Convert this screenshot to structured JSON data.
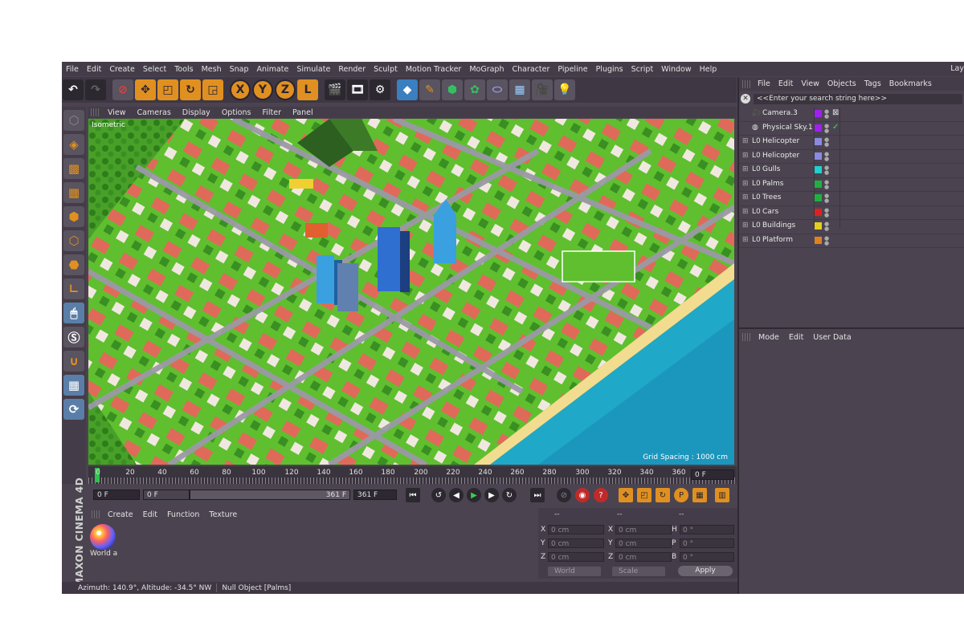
{
  "menubar": [
    "File",
    "Edit",
    "Create",
    "Select",
    "Tools",
    "Mesh",
    "Snap",
    "Animate",
    "Simulate",
    "Render",
    "Sculpt",
    "Motion Tracker",
    "MoGraph",
    "Character",
    "Pipeline",
    "Plugins",
    "Script",
    "Window",
    "Help"
  ],
  "layout_label": "Lay",
  "toolbar": {
    "axis_x": "X",
    "axis_y": "Y",
    "axis_z": "Z",
    "coord_icon": "L"
  },
  "view_menu": [
    "View",
    "Cameras",
    "Display",
    "Options",
    "Filter",
    "Panel"
  ],
  "viewport": {
    "label": "Isometric",
    "grid_spacing": "Grid Spacing : 1000 cm"
  },
  "timeline": {
    "ticks": [
      "0",
      "20",
      "40",
      "60",
      "80",
      "100",
      "120",
      "140",
      "160",
      "180",
      "200",
      "220",
      "240",
      "260",
      "280",
      "300",
      "320",
      "340",
      "360"
    ],
    "end_field": "0 F"
  },
  "transport": {
    "start": "0 F",
    "range_start": "0 F",
    "range_end": "361 F",
    "end": "361 F"
  },
  "material_menu": [
    "Create",
    "Edit",
    "Function",
    "Texture"
  ],
  "material": {
    "name": "World a"
  },
  "brand": "MAXON CINEMA 4D",
  "coords": {
    "headers": [
      "--",
      "--",
      "--"
    ],
    "rows": [
      {
        "a": "X",
        "av": "0 cm",
        "b": "X",
        "bv": "0 cm",
        "c": "H",
        "cv": "0 °"
      },
      {
        "a": "Y",
        "av": "0 cm",
        "b": "Y",
        "bv": "0 cm",
        "c": "P",
        "cv": "0 °"
      },
      {
        "a": "Z",
        "av": "0 cm",
        "b": "Z",
        "bv": "0 cm",
        "c": "B",
        "cv": "0 °"
      }
    ],
    "mode1": "World",
    "mode2": "Scale",
    "apply": "Apply"
  },
  "status": {
    "left": "Azimuth: 140.9°, Altitude: -34.5°  NW",
    "right": "Null Object [Palms]"
  },
  "object_menu": [
    "File",
    "Edit",
    "View",
    "Objects",
    "Tags",
    "Bookmarks"
  ],
  "object_search": "<<Enter your search string here>>",
  "objects": [
    {
      "name": "Camera.3",
      "color": "#a020f0"
    },
    {
      "name": "Physical Sky.1",
      "color": "#a020f0"
    },
    {
      "name": "Helicopter",
      "color": "#8a8ae0"
    },
    {
      "name": "Helicopter",
      "color": "#8a8ae0"
    },
    {
      "name": "Gulls",
      "color": "#20d0d0"
    },
    {
      "name": "Palms",
      "color": "#20b040"
    },
    {
      "name": "Trees",
      "color": "#20b040"
    },
    {
      "name": "Cars",
      "color": "#e02020"
    },
    {
      "name": "Buildings",
      "color": "#e0d020"
    },
    {
      "name": "Platform",
      "color": "#e08020"
    }
  ],
  "attr_menu": [
    "Mode",
    "Edit",
    "User Data"
  ]
}
